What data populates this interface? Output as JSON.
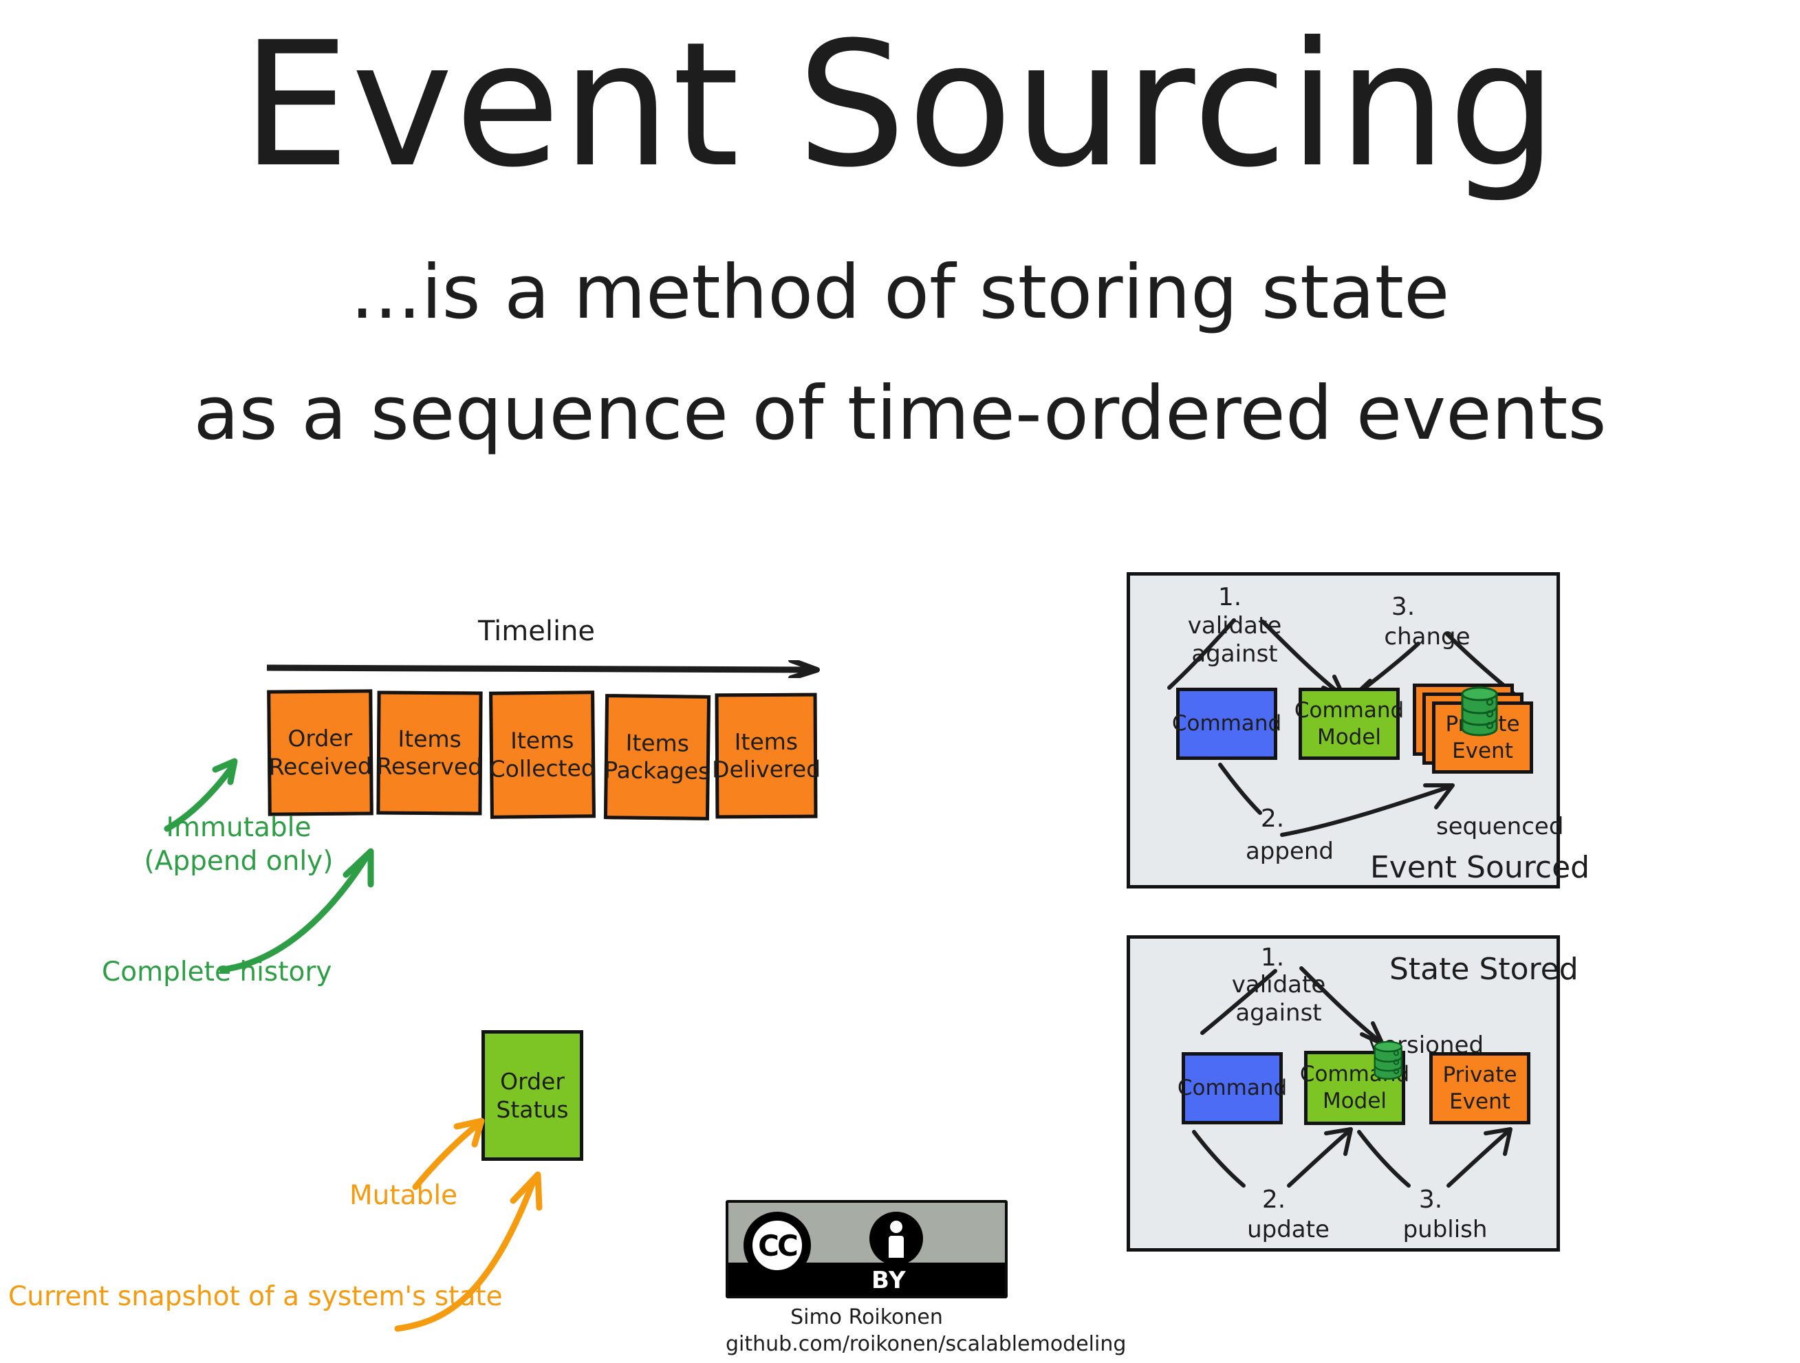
{
  "title": "Event Sourcing",
  "subtitle_line1": "...is a method of storing state",
  "subtitle_line2": "as a sequence of time-ordered events",
  "colors": {
    "orange": "#F7821E",
    "green": "#7CC524",
    "blue": "#4C6CF5",
    "panel_bg": "#E7EAED",
    "ink": "#131313",
    "annotation_green": "#2E9E46",
    "annotation_orange": "#F59B10",
    "cc_grey": "#A7ACA5"
  },
  "timeline": {
    "label": "Timeline",
    "axis_icon": "right-arrow-icon",
    "events": [
      {
        "line1": "Order",
        "line2": "Received"
      },
      {
        "line1": "Items",
        "line2": "Reserved"
      },
      {
        "line1": "Items",
        "line2": "Collected"
      },
      {
        "line1": "Items",
        "line2": "Packages"
      },
      {
        "line1": "Items",
        "line2": "Delivered"
      }
    ]
  },
  "annotations": {
    "immutable_line1": "Immutable",
    "immutable_line2": "(Append only)",
    "complete_history": "Complete history",
    "mutable": "Mutable",
    "current_snapshot": "Current snapshot of a system's state"
  },
  "order_status": {
    "line1": "Order",
    "line2": "Status"
  },
  "credits": {
    "license": "CC",
    "license_by": "BY",
    "author": "Simo Roikonen",
    "url": "github.com/roikonen/scalablemodeling"
  },
  "event_sourced": {
    "title": "Event Sourced",
    "command": "Command",
    "command_model_line1": "Command",
    "command_model_line2": "Model",
    "private_event_line1": "Private",
    "private_event_line2": "Event",
    "step1_num": "1.",
    "step1_line1": "validate",
    "step1_line2": "against",
    "step2_num": "2.",
    "step2_label": "append",
    "step3_num": "3.",
    "step3_label": "change",
    "store_note": "sequenced",
    "db_icon": "database-cylinder-icon"
  },
  "state_stored": {
    "title": "State Stored",
    "command": "Command",
    "command_model_line1": "Command",
    "command_model_line2": "Model",
    "private_event_line1": "Private",
    "private_event_line2": "Event",
    "step1_num": "1.",
    "step1_line1": "validate",
    "step1_line2": "against",
    "step2_num": "2.",
    "step2_label": "update",
    "step3_num": "3.",
    "step3_label": "publish",
    "store_note": "versioned",
    "db_icon": "database-cylinder-icon"
  }
}
